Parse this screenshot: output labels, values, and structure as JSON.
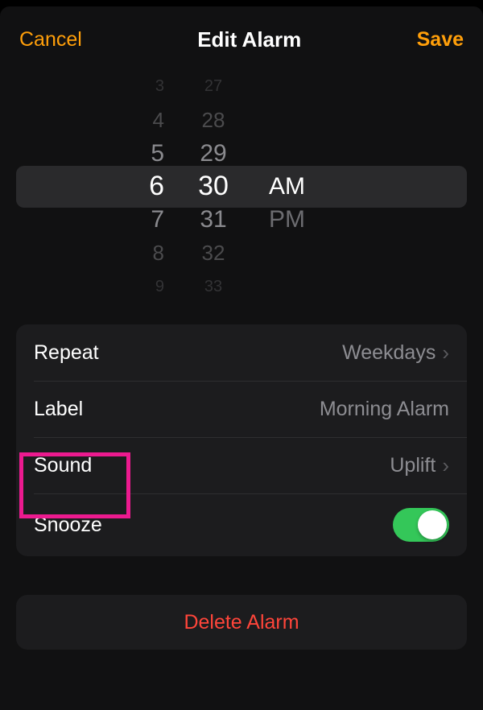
{
  "header": {
    "cancel": "Cancel",
    "title": "Edit Alarm",
    "save": "Save"
  },
  "picker": {
    "hours": [
      "3",
      "4",
      "5",
      "6",
      "7",
      "8",
      "9"
    ],
    "minutes": [
      "27",
      "28",
      "29",
      "30",
      "31",
      "32",
      "33"
    ],
    "ampm_selected": "AM",
    "ampm_other": "PM"
  },
  "settings": {
    "repeat": {
      "label": "Repeat",
      "value": "Weekdays"
    },
    "alarmLabel": {
      "label": "Label",
      "value": "Morning Alarm"
    },
    "sound": {
      "label": "Sound",
      "value": "Uplift"
    },
    "snooze": {
      "label": "Snooze",
      "on": true
    }
  },
  "deleteLabel": "Delete Alarm",
  "colors": {
    "accent": "#ff9f0a",
    "destructive": "#ff453a",
    "toggleOn": "#34c759",
    "highlightBox": "#ec1a8f"
  }
}
